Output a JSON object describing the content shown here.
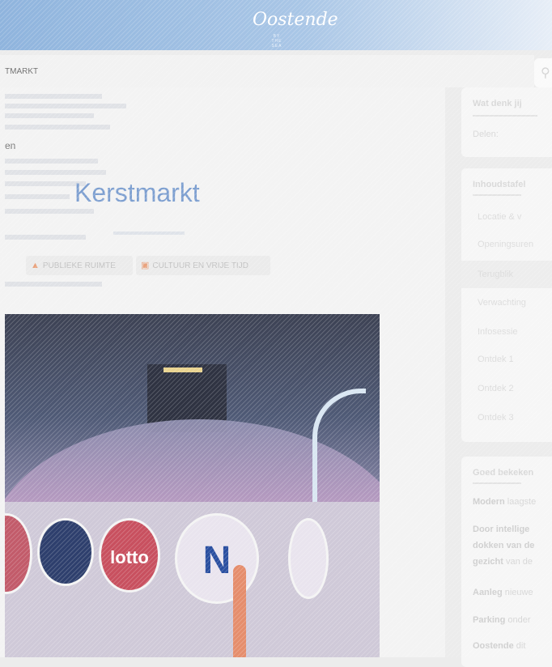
{
  "header": {
    "logo_text": "Oostende",
    "logo_sub": "BY THE SEA",
    "accent": "#8fb4dd"
  },
  "breadcrumb": {
    "current": "TMARKT"
  },
  "search": {
    "icon": "search-icon"
  },
  "page": {
    "partial_text": "en",
    "title": "Kerstmarkt",
    "title_color": "#7d9fd0",
    "tags": [
      {
        "label": "PUBLIEKE RUIMTE",
        "icon": "people-icon"
      },
      {
        "label": "CULTUUR EN VRIJE TIJD",
        "icon": "museum-icon"
      }
    ]
  },
  "photo": {
    "brand_discs": [
      "lotto",
      "N"
    ]
  },
  "sidebar": {
    "share_heading": "Wat denk jij",
    "share_label": "Delen:",
    "nav_heading": "Inhoudstafel",
    "nav_items": [
      {
        "label": "Locatie & v",
        "active": false
      },
      {
        "label": "Openingsuren",
        "active": false
      },
      {
        "label": "Terugblik",
        "active": true
      },
      {
        "label": "Verwachting",
        "active": false
      },
      {
        "label": "Infosessie",
        "active": false
      },
      {
        "label": "Ontdek 1",
        "active": false
      },
      {
        "label": "Ontdek 2",
        "active": false
      },
      {
        "label": "Ontdek 3",
        "active": false
      }
    ],
    "info_heading": "Goed bekeken",
    "info_lines": [
      {
        "bold": "Modern",
        "text": " laagste"
      },
      {
        "bold": "Door intellige",
        "text": ""
      },
      {
        "bold": "dokken van de",
        "text": ""
      },
      {
        "bold": "gezicht",
        "text": " van de"
      },
      {
        "bold": "Aanleg",
        "text": " nieuwe"
      },
      {
        "bold": "Parking",
        "text": " onder"
      },
      {
        "bold": "Oostende",
        "text": " dit"
      }
    ]
  }
}
